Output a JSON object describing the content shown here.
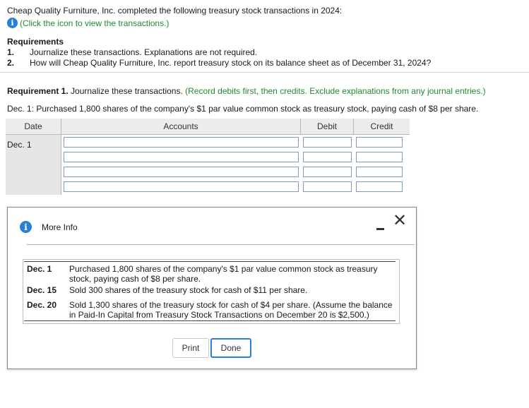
{
  "intro": "Cheap Quality Furniture, Inc. completed the following treasury stock transactions in 2024:",
  "click_link": "(Click the icon to view the transactions.)",
  "requirements": {
    "title": "Requirements",
    "items": [
      {
        "num": "1.",
        "text": "Journalize these transactions. Explanations are not required."
      },
      {
        "num": "2.",
        "text": "How will Cheap Quality Furniture, Inc. report treasury stock on its balance sheet as of December 31, 2024?"
      }
    ]
  },
  "requirement1": {
    "label": "Requirement 1.",
    "text": " Journalize these transactions.",
    "note": " (Record debits first, then credits. Exclude explanations from any journal entries.)"
  },
  "dec1_desc": "Dec. 1: Purchased 1,800 shares of the company's $1 par value common stock as treasury stock, paying cash of $8 per share.",
  "journal": {
    "headers": {
      "date": "Date",
      "accounts": "Accounts",
      "debit": "Debit",
      "credit": "Credit"
    },
    "date_value": "Dec. 1"
  },
  "modal": {
    "title": "More Info",
    "transactions": [
      {
        "date": "Dec. 1",
        "text": "Purchased 1,800 shares of the company's $1 par value common stock as treasury stock, paying cash of $8 per share."
      },
      {
        "date": "Dec. 15",
        "text": "Sold 300 shares of the treasury stock for cash of $11 per share."
      },
      {
        "date": "Dec. 20",
        "text": "Sold 1,300 shares of the treasury stock for cash of $4 per share. (Assume the balance in Paid-In Capital from Treasury Stock Transactions on December 20 is $2,500.)"
      }
    ],
    "print_label": "Print",
    "done_label": "Done"
  },
  "colors": {
    "accent": "#2a7fd4",
    "green": "#1f8a2e"
  },
  "icons": {
    "info": "info-icon",
    "minimize": "minimize-icon",
    "close": "close-icon"
  }
}
